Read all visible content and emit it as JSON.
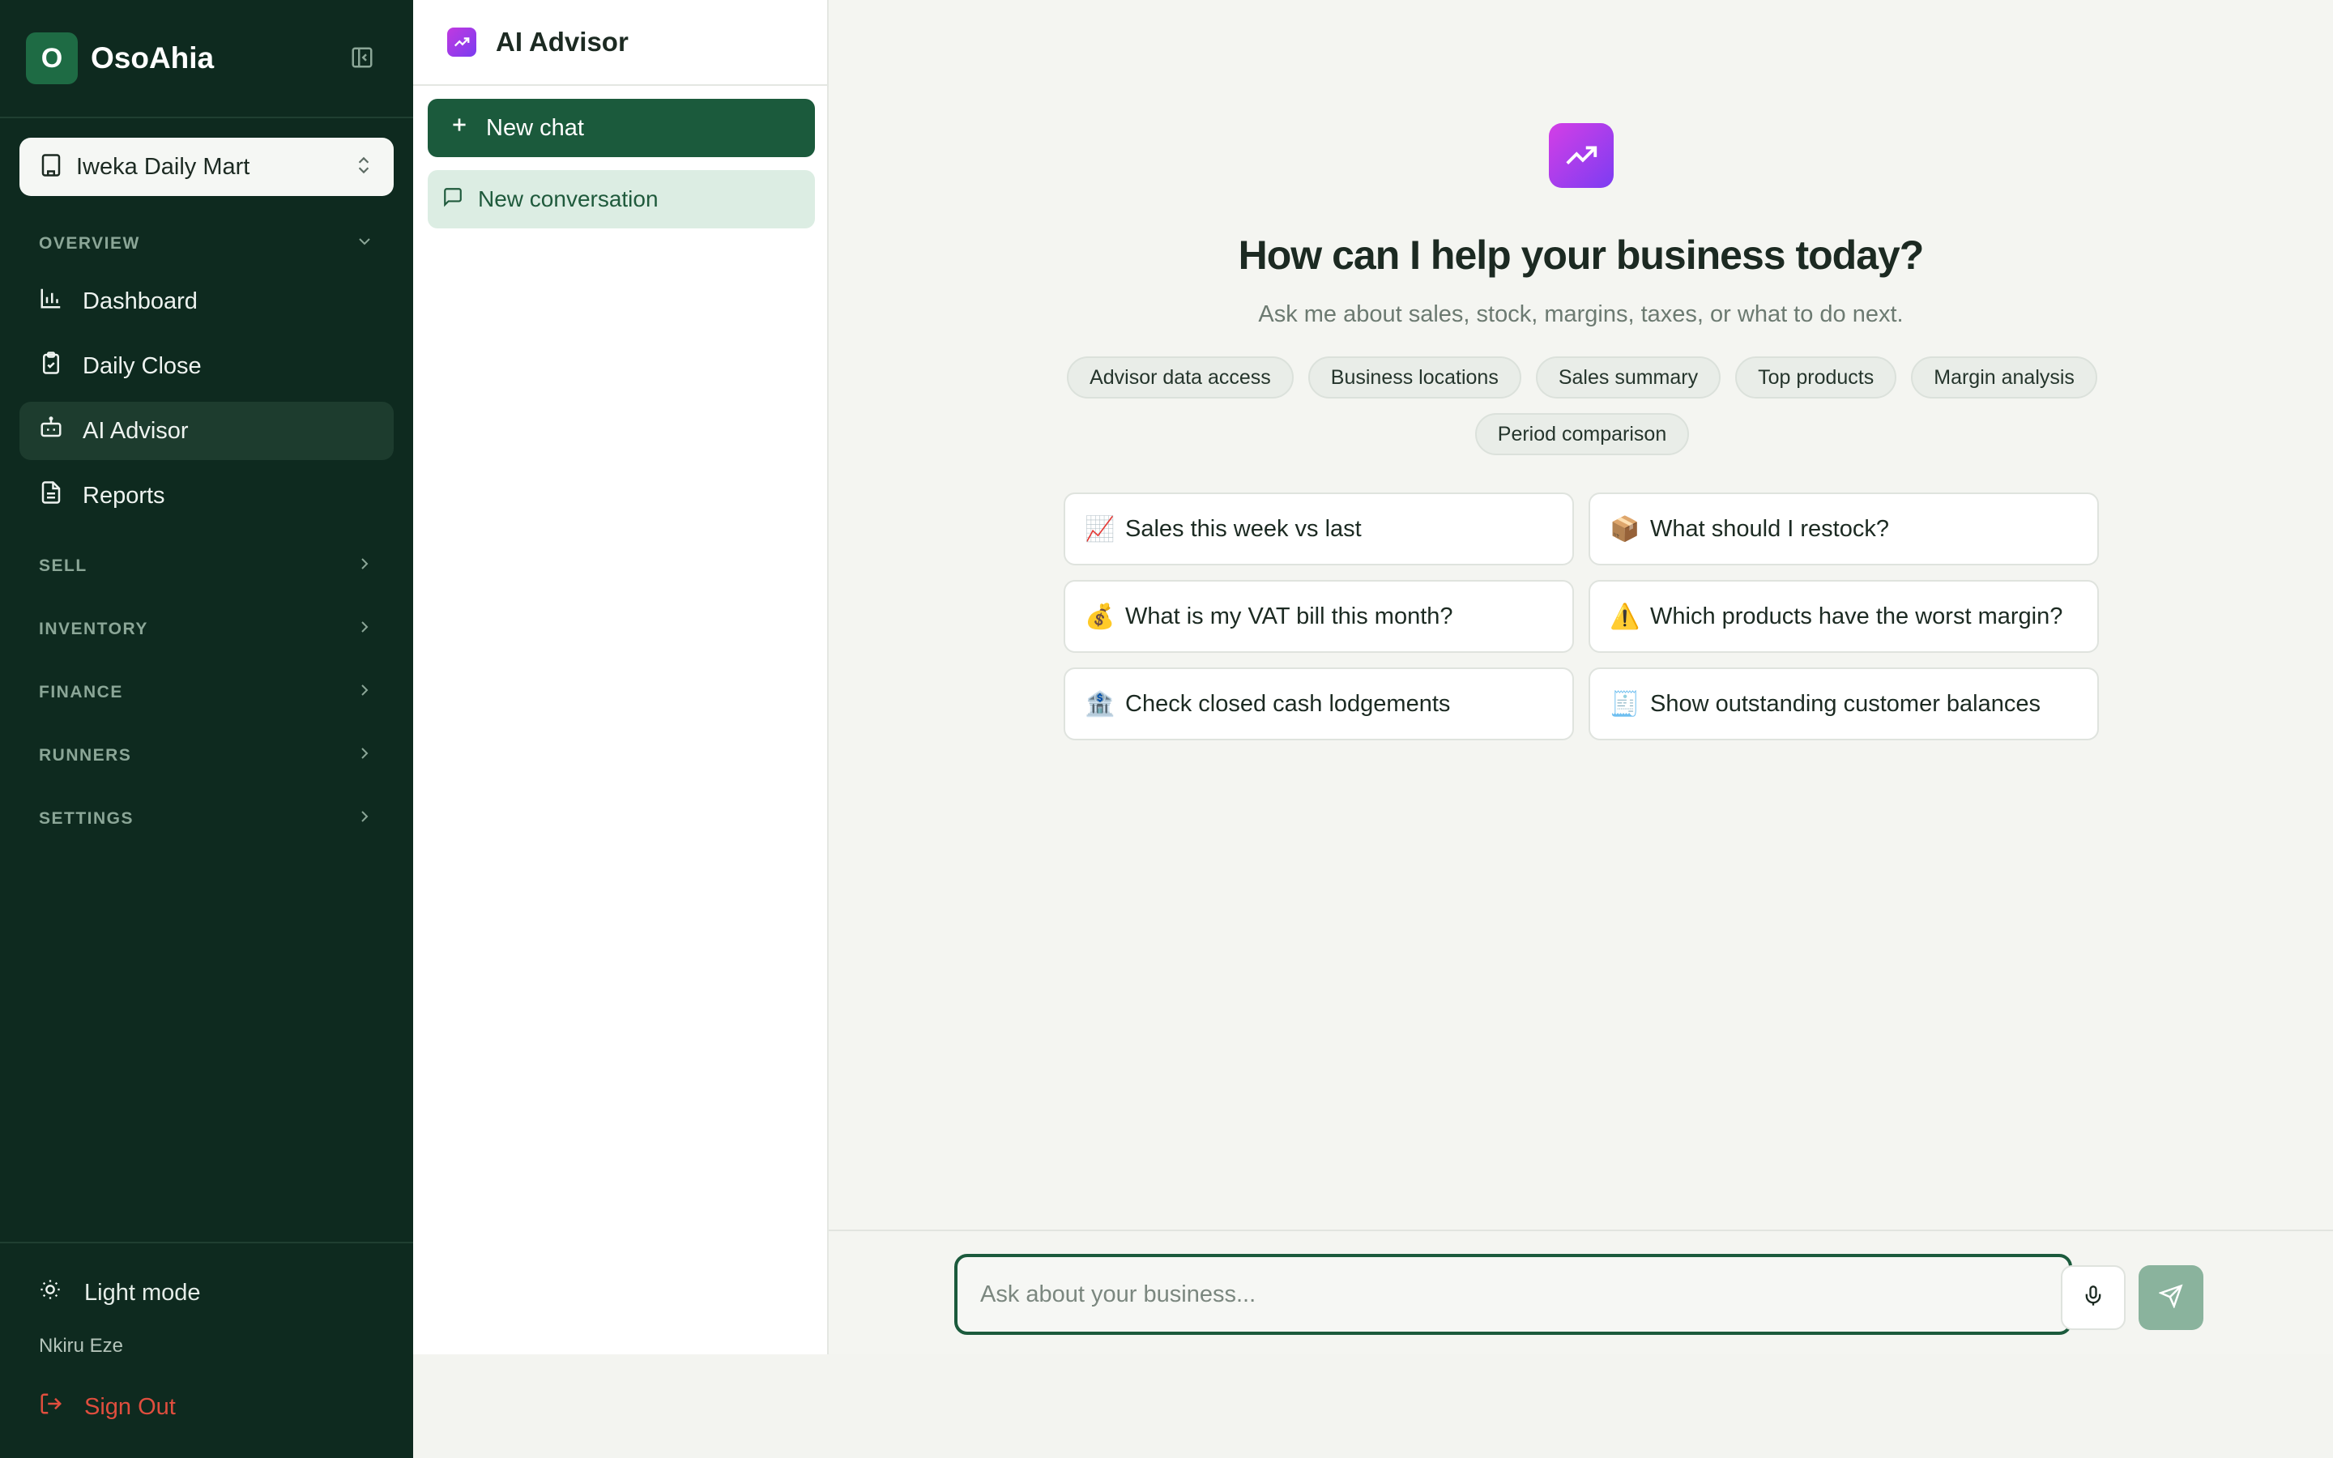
{
  "brand": {
    "logo_letter": "O",
    "name": "OsoAhia"
  },
  "store": {
    "name": "Iweka Daily Mart"
  },
  "sections": {
    "overview": "OVERVIEW",
    "sell": "SELL",
    "inventory": "INVENTORY",
    "finance": "FINANCE",
    "runners": "RUNNERS",
    "settings": "SETTINGS"
  },
  "nav": {
    "dashboard": "Dashboard",
    "daily_close": "Daily Close",
    "ai_advisor": "AI Advisor",
    "reports": "Reports"
  },
  "footer": {
    "theme_toggle": "Light mode",
    "user_name": "Nkiru Eze",
    "sign_out": "Sign Out"
  },
  "conversations": {
    "title": "AI Advisor",
    "new_chat": "New chat",
    "items": [
      "New conversation"
    ]
  },
  "hero": {
    "title": "How can I help your business today?",
    "subtitle": "Ask me about sales, stock, margins, taxes, or what to do next."
  },
  "chips": [
    "Advisor data access",
    "Business locations",
    "Sales summary",
    "Top products",
    "Margin analysis",
    "Period comparison"
  ],
  "suggestions": [
    {
      "emoji": "📈",
      "label": "Sales this week vs last"
    },
    {
      "emoji": "📦",
      "label": "What should I restock?"
    },
    {
      "emoji": "💰",
      "label": "What is my VAT bill this month?"
    },
    {
      "emoji": "⚠️",
      "label": "Which products have the worst margin?"
    },
    {
      "emoji": "🏦",
      "label": "Check closed cash lodgements"
    },
    {
      "emoji": "🧾",
      "label": "Show outstanding customer balances"
    }
  ],
  "composer": {
    "placeholder": "Ask about your business..."
  },
  "colors": {
    "sidebar_bg": "#0e2a1f",
    "primary": "#1b5a3c",
    "accent_gradient_start": "#d43ee6",
    "accent_gradient_end": "#7c3df2",
    "danger": "#e04e3e"
  }
}
